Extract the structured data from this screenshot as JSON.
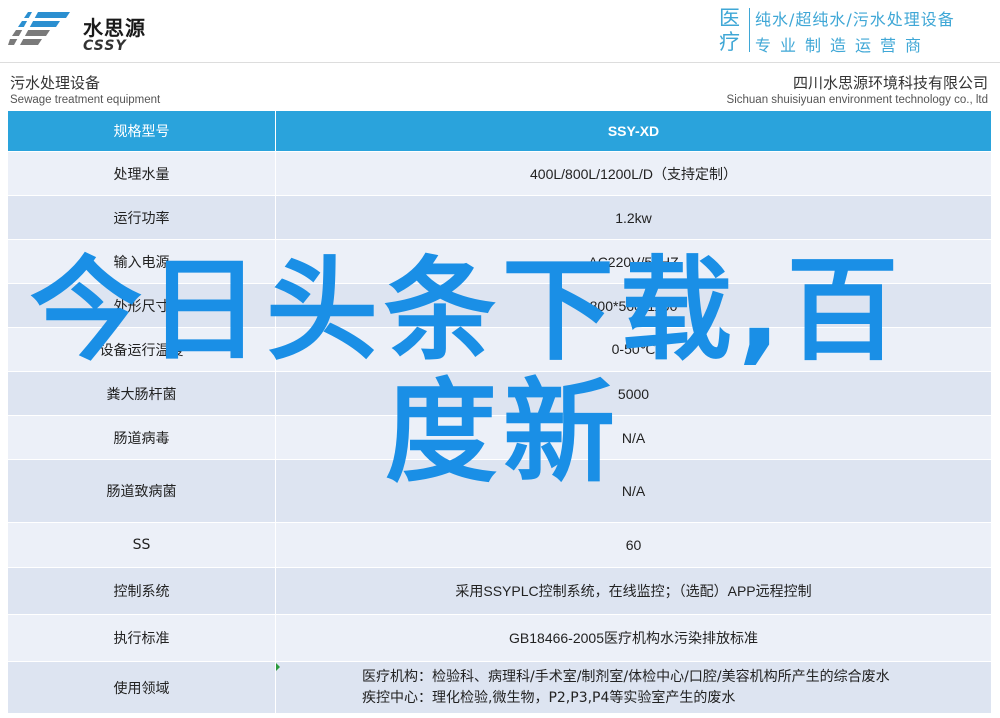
{
  "header": {
    "logo": {
      "cn": "水思源",
      "en": "CSSY"
    },
    "slogan": {
      "big": "医疗",
      "line1": "纯水/超纯水/污水处理设备",
      "line2": "专业制造运营商"
    }
  },
  "subheader": {
    "left_cn": "污水处理设备",
    "left_en": "Sewage treatment equipment",
    "right_cn": "四川水思源环境科技有限公司",
    "right_en": "Sichuan shuisiyuan environment technology co., ltd"
  },
  "table": {
    "header": {
      "label": "规格型号",
      "value": "SSY-XD"
    },
    "rows": [
      {
        "label": "处理水量",
        "value": "400L/800L/1200L/D（支持定制）"
      },
      {
        "label": "运行功率",
        "value": "1.2kw"
      },
      {
        "label": "输入电源",
        "value": "AC220V/50HZ"
      },
      {
        "label": "外形尺寸",
        "value": "800*560*1100"
      },
      {
        "label": "设备运行温度",
        "value": "0-50℃"
      },
      {
        "label": "粪大肠杆菌",
        "value": "5000"
      },
      {
        "label": "肠道病毒",
        "value": "N/A"
      },
      {
        "label": "肠道致病菌",
        "value": "N/A"
      },
      {
        "label": "SS",
        "value": "60"
      },
      {
        "label": "控制系统",
        "value": "采用SSYPLC控制系统，在线监控；（选配）APP远程控制"
      },
      {
        "label": "执行标准",
        "value": "GB18466-2005医疗机构水污染排放标准"
      },
      {
        "label": "使用领域",
        "value_line1": "医疗机构：检验科、病理科/手术室/制剂室/体检中心/口腔/美容机构所产生的综合废水",
        "value_line2": "疾控中心：理化检验,微生物，P2,P3,P4等实验室产生的废水"
      }
    ]
  },
  "watermark": {
    "line1": "今日头条下载,百",
    "line2": "度新"
  },
  "colors": {
    "accent": "#2aa3dc",
    "slogan": "#3fa7d6",
    "watermark": "#1a8fe6",
    "row_light": "#ecf0f8",
    "row_dark": "#dde4f1"
  }
}
